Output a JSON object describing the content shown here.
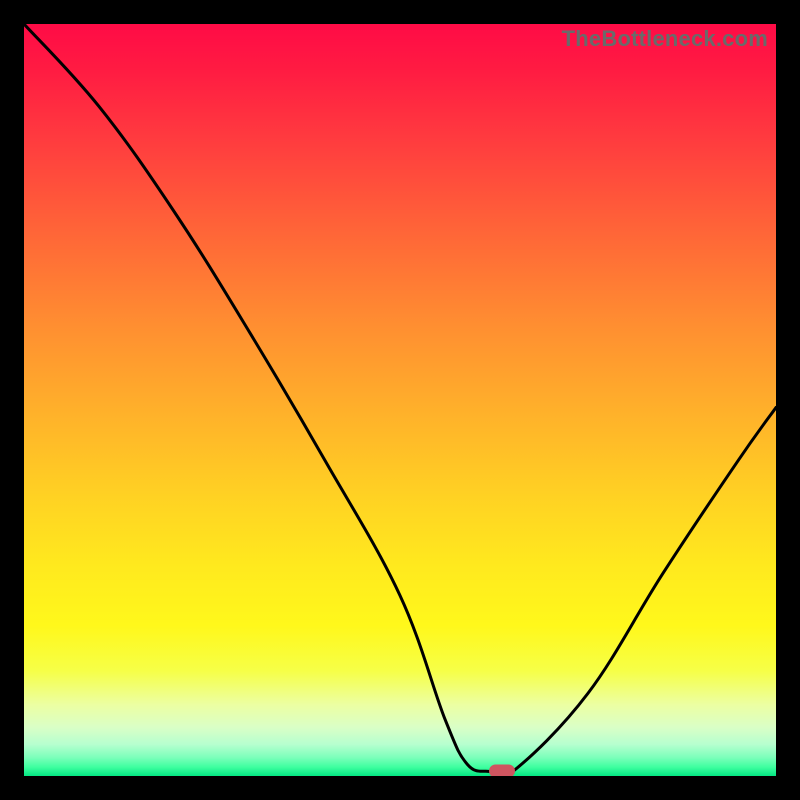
{
  "watermark": "TheBottleneck.com",
  "marker": {
    "color": "#cf5560"
  },
  "gradient": {
    "stops": [
      {
        "offset": 0.0,
        "color": "#ff0b46"
      },
      {
        "offset": 0.06,
        "color": "#ff1b42"
      },
      {
        "offset": 0.15,
        "color": "#ff3a3f"
      },
      {
        "offset": 0.27,
        "color": "#ff6338"
      },
      {
        "offset": 0.4,
        "color": "#ff8e31"
      },
      {
        "offset": 0.52,
        "color": "#ffb22a"
      },
      {
        "offset": 0.63,
        "color": "#ffd223"
      },
      {
        "offset": 0.72,
        "color": "#ffe91e"
      },
      {
        "offset": 0.8,
        "color": "#fff81b"
      },
      {
        "offset": 0.86,
        "color": "#f6ff47"
      },
      {
        "offset": 0.905,
        "color": "#ecffa2"
      },
      {
        "offset": 0.935,
        "color": "#daffc6"
      },
      {
        "offset": 0.958,
        "color": "#b6ffcf"
      },
      {
        "offset": 0.975,
        "color": "#7dffbb"
      },
      {
        "offset": 0.988,
        "color": "#3fffa0"
      },
      {
        "offset": 1.0,
        "color": "#04e683"
      }
    ]
  },
  "chart_data": {
    "type": "line",
    "title": "",
    "xlabel": "",
    "ylabel": "",
    "xlim": [
      0,
      100
    ],
    "ylim": [
      0,
      100
    ],
    "grid": false,
    "series": [
      {
        "name": "curve",
        "x": [
          0,
          10,
          20,
          30,
          40,
          50,
          56,
          59,
          62,
          65,
          75,
          85,
          95,
          100
        ],
        "values": [
          100,
          89,
          75,
          59,
          42,
          24,
          7.5,
          1.5,
          0.6,
          0.6,
          11,
          27,
          42,
          49
        ]
      }
    ],
    "marker_point": {
      "x": 63.5,
      "y": 0.6
    }
  }
}
